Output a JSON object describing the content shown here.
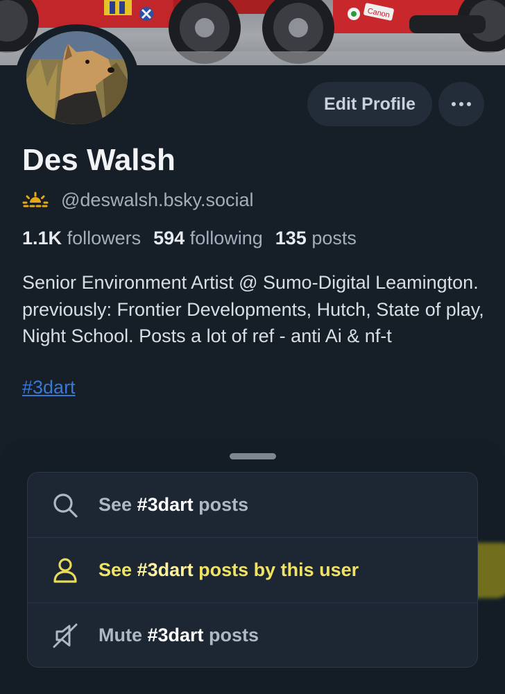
{
  "banner": {
    "brand_text": "Canon"
  },
  "profile": {
    "name": "Des Walsh",
    "handle": "@deswalsh.bsky.social",
    "edit_button": "Edit Profile",
    "stats": {
      "followers_count": "1.1K",
      "followers_label": "followers",
      "following_count": "594",
      "following_label": "following",
      "posts_count": "135",
      "posts_label": "posts"
    },
    "bio": "Senior Environment Artist @ Sumo-Digital Leamington. previously: Frontier Developments, Hutch, State of play, Night School. Posts a lot of ref - anti Ai & nf-t",
    "hashtag": "#3dart"
  },
  "sheet": {
    "items": [
      {
        "icon": "search-icon",
        "pre": "See ",
        "tag": "#3dart",
        "post": " posts"
      },
      {
        "icon": "person-icon",
        "pre": "See ",
        "tag": "#3dart",
        "post": " posts by this user"
      },
      {
        "icon": "mute-icon",
        "pre": "Mute ",
        "tag": "#3dart",
        "post": " posts"
      }
    ]
  },
  "colors": {
    "background": "#161e27",
    "highlight": "#d8d01c",
    "link": "#3a78d6"
  }
}
